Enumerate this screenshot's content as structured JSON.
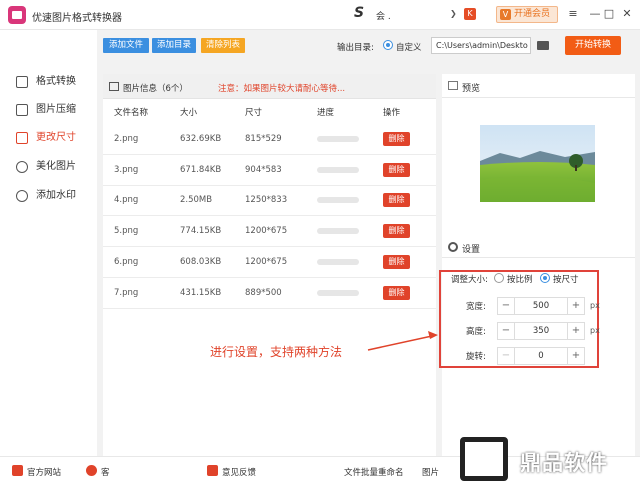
{
  "app": {
    "title": "优速图片格式转换器",
    "user_text": "会 .",
    "vip_label": "开通会员",
    "vip_icon": "VIP"
  },
  "window_controls": {
    "menu": "≡",
    "minimize": "—",
    "maximize": "□",
    "close": "✕"
  },
  "sidebar": {
    "items": [
      {
        "label": "格式转换",
        "active": false
      },
      {
        "label": "图片压缩",
        "active": false
      },
      {
        "label": "更改尺寸",
        "active": true
      },
      {
        "label": "美化图片",
        "active": false
      },
      {
        "label": "添加水印",
        "active": false
      }
    ]
  },
  "toolbar": {
    "add_file": "添加文件",
    "add_dir": "添加目录",
    "clear_list": "清除列表",
    "output_label": "输出目录:",
    "custom_label": "自定义",
    "output_path": "C:\\Users\\admin\\Deskto",
    "start_button": "开始转换"
  },
  "list": {
    "title": "图片信息（6个）",
    "note": "注意：如果图片较大请耐心等待...",
    "columns": [
      "文件名称",
      "大小",
      "尺寸",
      "进度",
      "操作"
    ],
    "delete_label": "删除",
    "rows": [
      {
        "name": "2.png",
        "size": "632.69KB",
        "dims": "815*529"
      },
      {
        "name": "3.png",
        "size": "671.84KB",
        "dims": "904*583"
      },
      {
        "name": "4.png",
        "size": "2.50MB",
        "dims": "1250*833"
      },
      {
        "name": "5.png",
        "size": "774.15KB",
        "dims": "1200*675"
      },
      {
        "name": "6.png",
        "size": "608.03KB",
        "dims": "1200*675"
      },
      {
        "name": "7.png",
        "size": "431.15KB",
        "dims": "889*500"
      }
    ]
  },
  "preview": {
    "label": "预览"
  },
  "settings": {
    "label": "设置",
    "resize_label": "调整大小:",
    "option_ratio": "按比例",
    "option_size": "按尺寸",
    "width_label": "宽度:",
    "width_value": "500",
    "height_label": "高度:",
    "height_value": "350",
    "rotate_label": "旋转:",
    "rotate_value": "0",
    "unit": "px",
    "minus": "−",
    "plus": "+"
  },
  "annotation": "进行设置，支持两种方法",
  "footer": {
    "website": "官方网站",
    "service": "客",
    "feedback": "意见反馈",
    "batch_rename": "文件批量重命名",
    "pic": "图片"
  },
  "watermark": {
    "text": "鼎品软件"
  },
  "colors": {
    "accent_blue": "#3b8fe0",
    "accent_orange": "#f25c15",
    "danger_red": "#e0432a",
    "warning_yellow": "#f5a623"
  }
}
